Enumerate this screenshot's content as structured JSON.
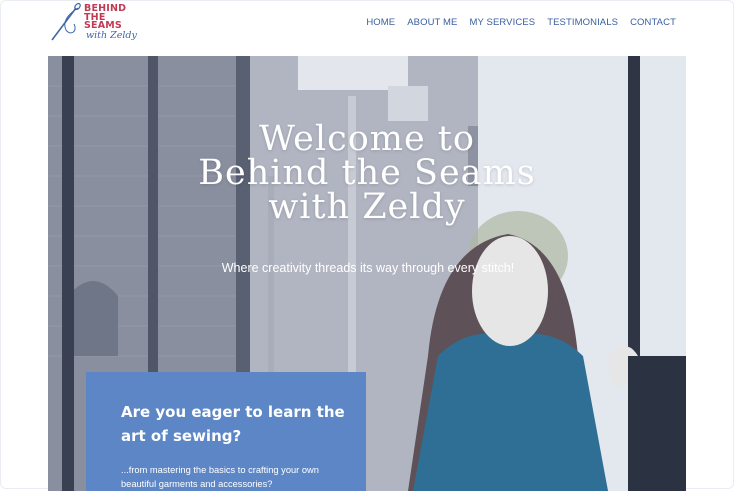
{
  "brand": {
    "logo_line1": "BEHIND",
    "logo_line2": "THE",
    "logo_line3": "SEAMS",
    "logo_script": "with Zeldy",
    "logo_color": "#c23b52",
    "script_color": "#3e66a6",
    "icon": "needle-and-thread-icon"
  },
  "nav": {
    "items": [
      "HOME",
      "ABOUT ME",
      "MY SERVICES",
      "TESTIMONIALS",
      "CONTACT"
    ],
    "color": "#3a5fa0"
  },
  "hero": {
    "title_line1": "Welcome to",
    "title_line2": "Behind the Seams",
    "title_line3": "with Zeldy",
    "subtitle": "Where creativity threads its way through every stitch!"
  },
  "card": {
    "heading": "Are you eager to learn the art of sewing?",
    "text": "...from mastering the basics to crafting your own beautiful garments and accessories?",
    "background": "#5c86c6"
  }
}
